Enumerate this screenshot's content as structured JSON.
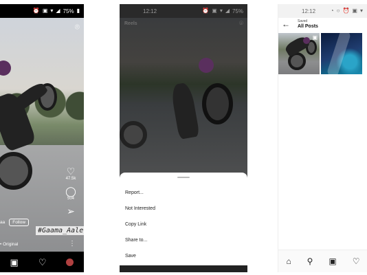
{
  "screen1": {
    "status_time": "",
    "status_icons": [
      "alarm-icon",
      "message-icon",
      "wifi-icon",
      "signal-icon",
      "battery-icon"
    ],
    "battery": "75%",
    "likes": "47.5k",
    "comments": "504",
    "username": "aa",
    "follow_label": "Follow",
    "hashtag": "#Gaama_Aale",
    "audio": "• Original"
  },
  "screen2": {
    "status_time": "12:12",
    "battery": "75%",
    "title": "Reels",
    "menu": [
      "Report...",
      "Not Interested",
      "Copy Link",
      "Share to...",
      "Save"
    ]
  },
  "screen3": {
    "status_time": "12:12",
    "battery": "",
    "header_sub": "Saved",
    "header_title": "All Posts"
  },
  "colors": {
    "overlay_bg": "#000000",
    "sheet_bg": "#ffffff",
    "text_dark": "#222222"
  }
}
